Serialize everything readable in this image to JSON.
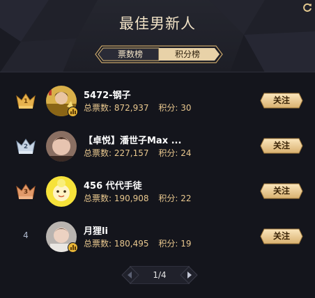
{
  "header": {
    "title": "最佳男新人",
    "refresh_icon": "refresh-icon"
  },
  "tabs": [
    {
      "label": "票数榜",
      "active": true
    },
    {
      "label": "积分榜",
      "active": false
    }
  ],
  "list": [
    {
      "rank": "1",
      "rank_style": "gold-crown",
      "name": "5472-钢子",
      "votes_label": "总票数:",
      "votes": "872,937",
      "score_label": "积分:",
      "score": "30",
      "has_badge": true,
      "follow_label": "关注"
    },
    {
      "rank": "2",
      "rank_style": "silver-crown",
      "name": "【卓悦】潘世子Max ...",
      "votes_label": "总票数:",
      "votes": "227,157",
      "score_label": "积分:",
      "score": "24",
      "has_badge": false,
      "follow_label": "关注"
    },
    {
      "rank": "3",
      "rank_style": "bronze-crown",
      "name": "456 代代手徒",
      "votes_label": "总票数:",
      "votes": "190,908",
      "score_label": "积分:",
      "score": "22",
      "has_badge": false,
      "follow_label": "关注"
    },
    {
      "rank": "4",
      "rank_style": "plain",
      "name": "月狸li",
      "votes_label": "总票数:",
      "votes": "180,495",
      "score_label": "积分:",
      "score": "19",
      "has_badge": true,
      "follow_label": "关注"
    }
  ],
  "pager": {
    "label": "1/4"
  },
  "colors": {
    "background": "#14151c",
    "accent_gold": "#e8c78e",
    "title": "#f1e2c6"
  }
}
